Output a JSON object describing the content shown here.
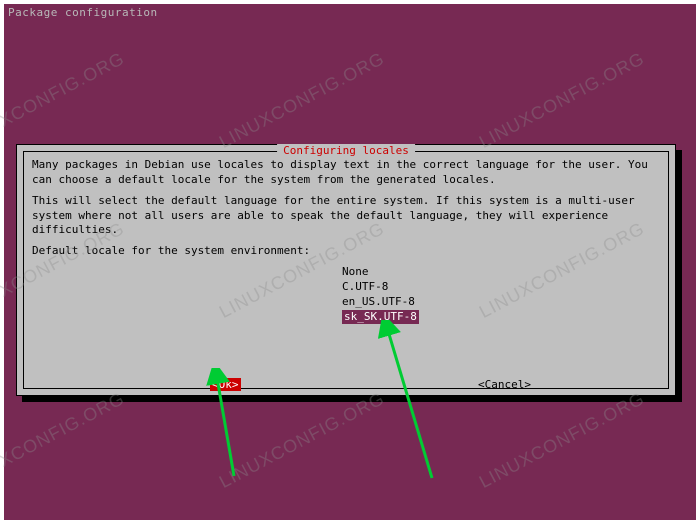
{
  "header": {
    "title": "Package configuration"
  },
  "dialog": {
    "title": "Configuring locales",
    "para1": "Many packages in Debian use locales to display text in the correct language for the user. You can choose a default locale for the system from the generated locales.",
    "para2": "This will select the default language for the entire system. If this system is a multi-user system where not all users are able to speak the default language, they will experience difficulties.",
    "prompt": "Default locale for the system environment:",
    "options": [
      {
        "label": "None",
        "selected": false
      },
      {
        "label": "C.UTF-8",
        "selected": false
      },
      {
        "label": "en_US.UTF-8",
        "selected": false
      },
      {
        "label": "sk_SK.UTF-8",
        "selected": true
      }
    ],
    "ok_label": "<Ok>",
    "cancel_label": "<Cancel>"
  },
  "watermark": "LINUXCONFIG.ORG"
}
